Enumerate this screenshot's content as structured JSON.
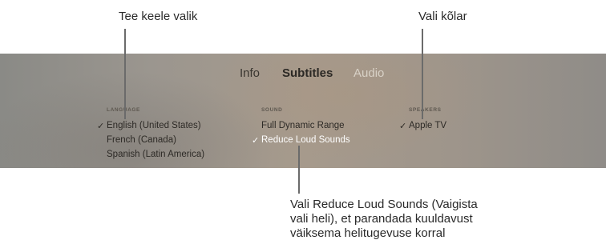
{
  "callouts": {
    "language": "Tee keele valik",
    "speakers": "Vali kõlar",
    "reduce": "Vali Reduce Loud Sounds (Vaigista\nvali heli), et parandada kuuldavust\nväiksema helitugevuse korral"
  },
  "tabs": [
    {
      "label": "Info"
    },
    {
      "label": "Subtitles"
    },
    {
      "label": "Audio"
    }
  ],
  "language": {
    "header": "LANGUAGE",
    "options": [
      {
        "label": "English (United States)",
        "selected": true
      },
      {
        "label": "French (Canada)",
        "selected": false
      },
      {
        "label": "Spanish (Latin America)",
        "selected": false
      }
    ]
  },
  "sound": {
    "header": "SOUND",
    "options": [
      {
        "label": "Full Dynamic Range",
        "selected": false
      },
      {
        "label": "Reduce Loud Sounds",
        "selected": true
      }
    ]
  },
  "speakers": {
    "header": "SPEAKERS",
    "options": [
      {
        "label": "Apple TV",
        "selected": true
      }
    ]
  },
  "check_glyph": "✓"
}
